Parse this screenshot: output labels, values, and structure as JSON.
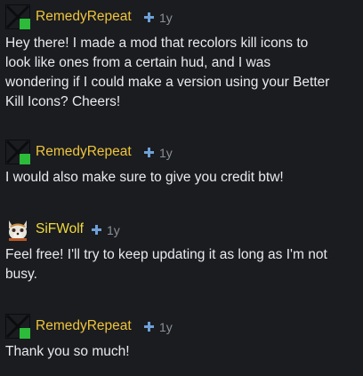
{
  "comments": [
    {
      "user": "RemedyRepeat",
      "age": "1y",
      "avatar_icon": "broken-avatar-icon",
      "lines": [
        "Hey there! I made a mod that recolors kill icons to",
        "look like ones from a certain hud, and I was",
        "wondering if I could make a version using your Better",
        "Kill Icons? Cheers!"
      ]
    },
    {
      "user": "RemedyRepeat",
      "age": "1y",
      "avatar_icon": "broken-avatar-icon",
      "lines": [
        "I would also make sure to give you credit btw!"
      ]
    },
    {
      "user": "SiFWolf",
      "age": "1y",
      "avatar_icon": "wolf-avatar-icon",
      "lines": [
        "Feel free! I'll try to keep updating it as long as I'm not",
        "busy."
      ]
    },
    {
      "user": "RemedyRepeat",
      "age": "1y",
      "avatar_icon": "broken-avatar-icon",
      "lines": [
        "Thank you so much!"
      ]
    }
  ],
  "colors": {
    "background": "#1a1c20",
    "username_remedy": "#f0c43a",
    "username_sifwolf": "#f2d93a",
    "plus_badge": "#6fa0d8",
    "age_text": "#8b9096",
    "body_text": "#e8eaec"
  }
}
